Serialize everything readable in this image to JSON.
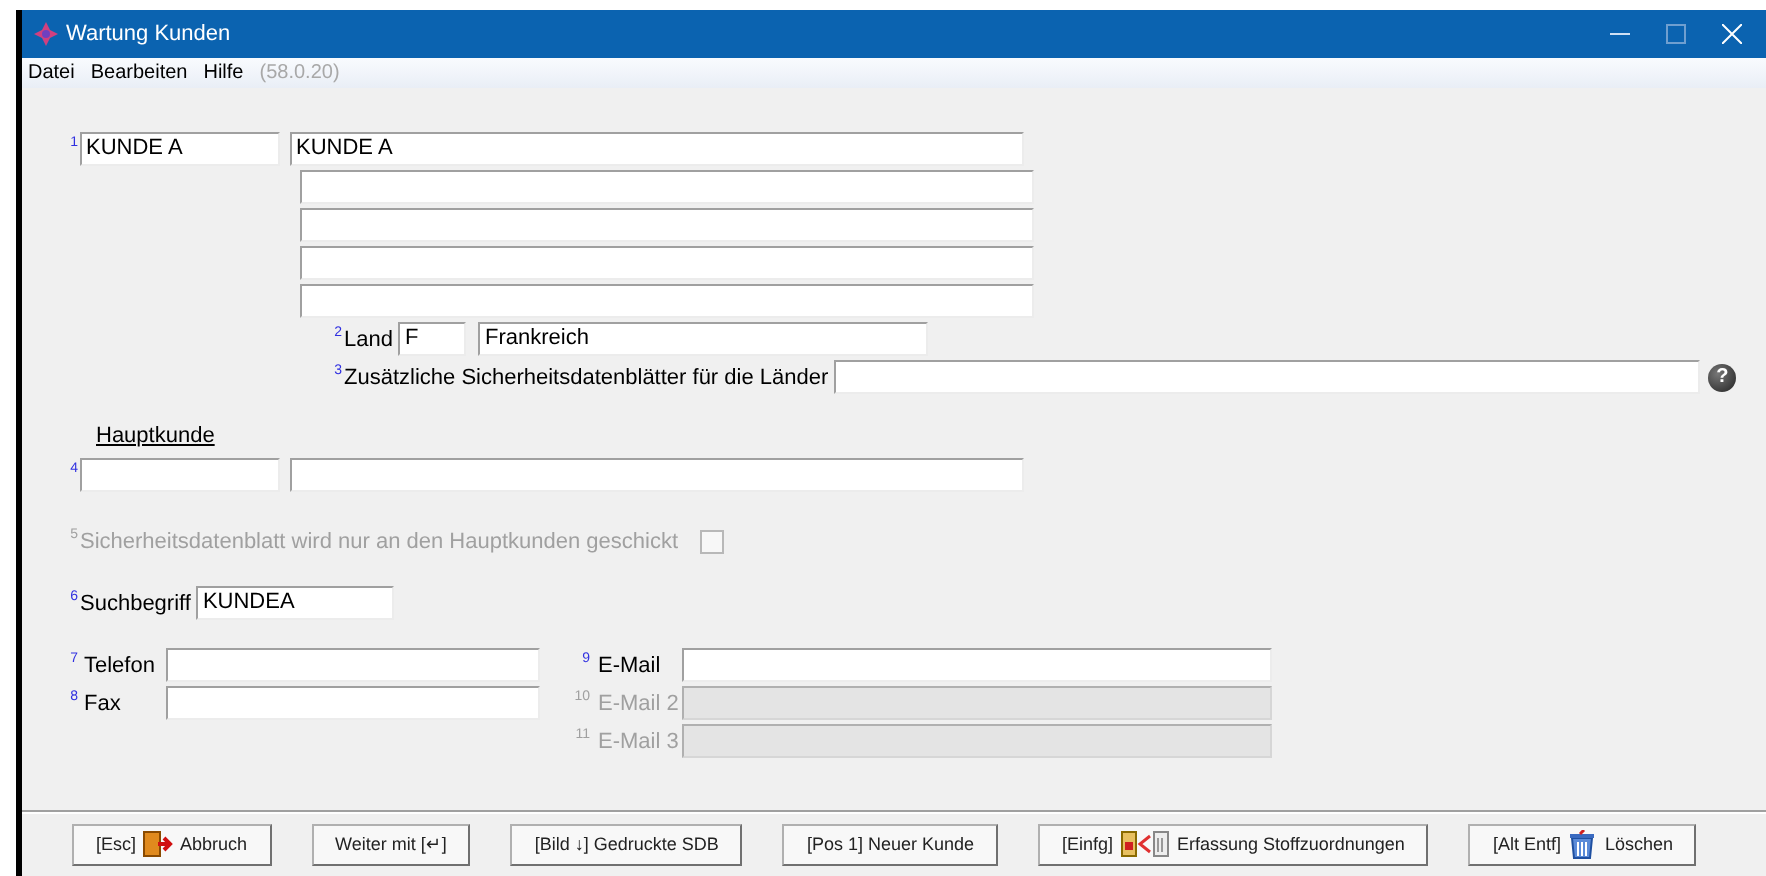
{
  "window": {
    "title": "Wartung Kunden"
  },
  "menu": {
    "items": [
      {
        "label": "Datei"
      },
      {
        "label": "Bearbeiten"
      },
      {
        "label": "Hilfe"
      }
    ],
    "version": "(58.0.20)"
  },
  "customer": {
    "index": "1",
    "code": {
      "value": "KUNDE A"
    },
    "name_lines": [
      {
        "value": "KUNDE A"
      }
    ]
  },
  "country": {
    "index": "2",
    "label": "Land",
    "code": {
      "value": "F"
    },
    "name": {
      "value": "Frankreich"
    }
  },
  "extra_countries": {
    "index": "3",
    "label": "Zusätzliche Sicherheitsdatenblätter für die Länder",
    "help": "?"
  },
  "main_customer": {
    "heading": "Hauptkunde",
    "index": "4"
  },
  "send_to_main": {
    "index": "5",
    "label": "Sicherheitsdatenblatt wird nur an den Hauptkunden geschickt",
    "disabled": true,
    "checked": false
  },
  "search_term": {
    "index": "6",
    "label": "Suchbegriff",
    "field": {
      "value": "KUNDEA"
    }
  },
  "contacts": [
    {
      "index": "7",
      "label": "Telefon"
    },
    {
      "index": "8",
      "label": "Fax"
    }
  ],
  "emails": [
    {
      "index": "9",
      "label": "E-Mail",
      "disabled": false
    },
    {
      "index": "10",
      "label": "E-Mail 2",
      "disabled": true
    },
    {
      "index": "11",
      "label": "E-Mail 3",
      "disabled": true
    }
  ],
  "buttons": [
    {
      "key": "[Esc]",
      "kind": "exit",
      "label": "Abbruch"
    },
    {
      "label": "Weiter mit [↵]"
    },
    {
      "key": "[Bild ↓]",
      "label": "Gedruckte SDB"
    },
    {
      "key": "[Pos 1]",
      "label": "Neuer Kunde"
    },
    {
      "key": "[Einfg]",
      "kind": "assign",
      "label": "Erfassung Stoffzuordnungen"
    },
    {
      "key": "[Alt Entf]",
      "kind": "delete",
      "label": "Löschen"
    }
  ]
}
